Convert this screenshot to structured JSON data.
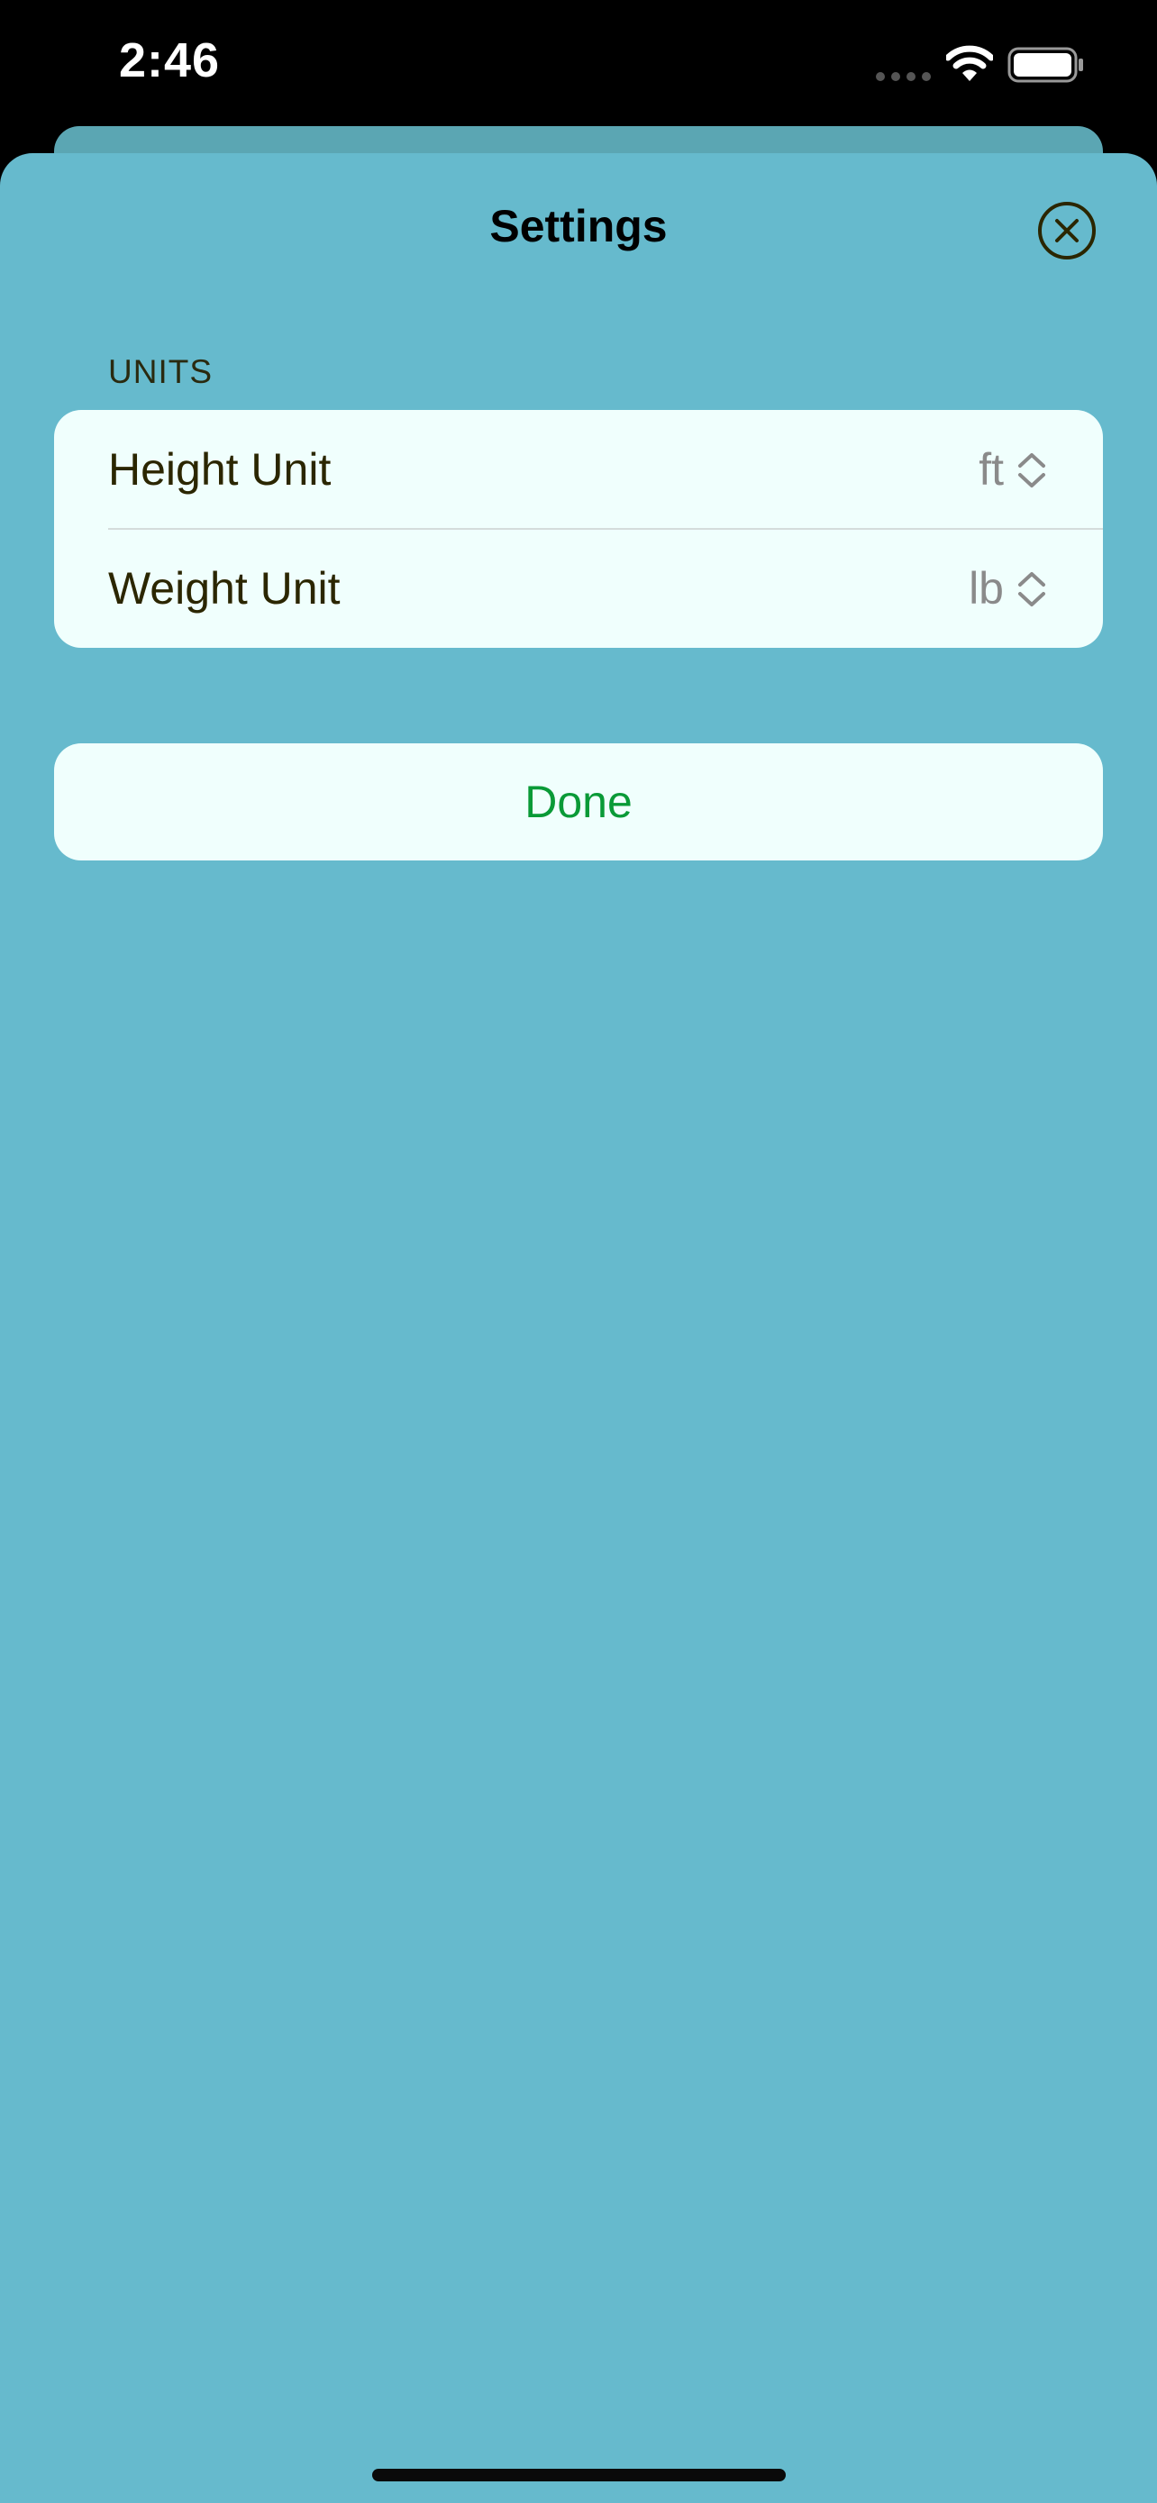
{
  "status_bar": {
    "time": "2:46",
    "icons": [
      "signal-dots-icon",
      "wifi-icon",
      "battery-icon"
    ]
  },
  "sheet": {
    "title": "Settings",
    "close_icon": "close-circle-icon"
  },
  "units_section": {
    "header": "UNITS",
    "rows": [
      {
        "label": "Height Unit",
        "value": "ft",
        "icon": "chevron-updown-icon"
      },
      {
        "label": "Weight Unit",
        "value": "lb",
        "icon": "chevron-updown-icon"
      }
    ]
  },
  "done_button": {
    "label": "Done"
  },
  "colors": {
    "sheet_background": "#66bacd",
    "card_background": "#f0fffd",
    "accent_green": "#0a9a37",
    "label_text": "#2b2600",
    "value_text": "#8a8a8a"
  }
}
